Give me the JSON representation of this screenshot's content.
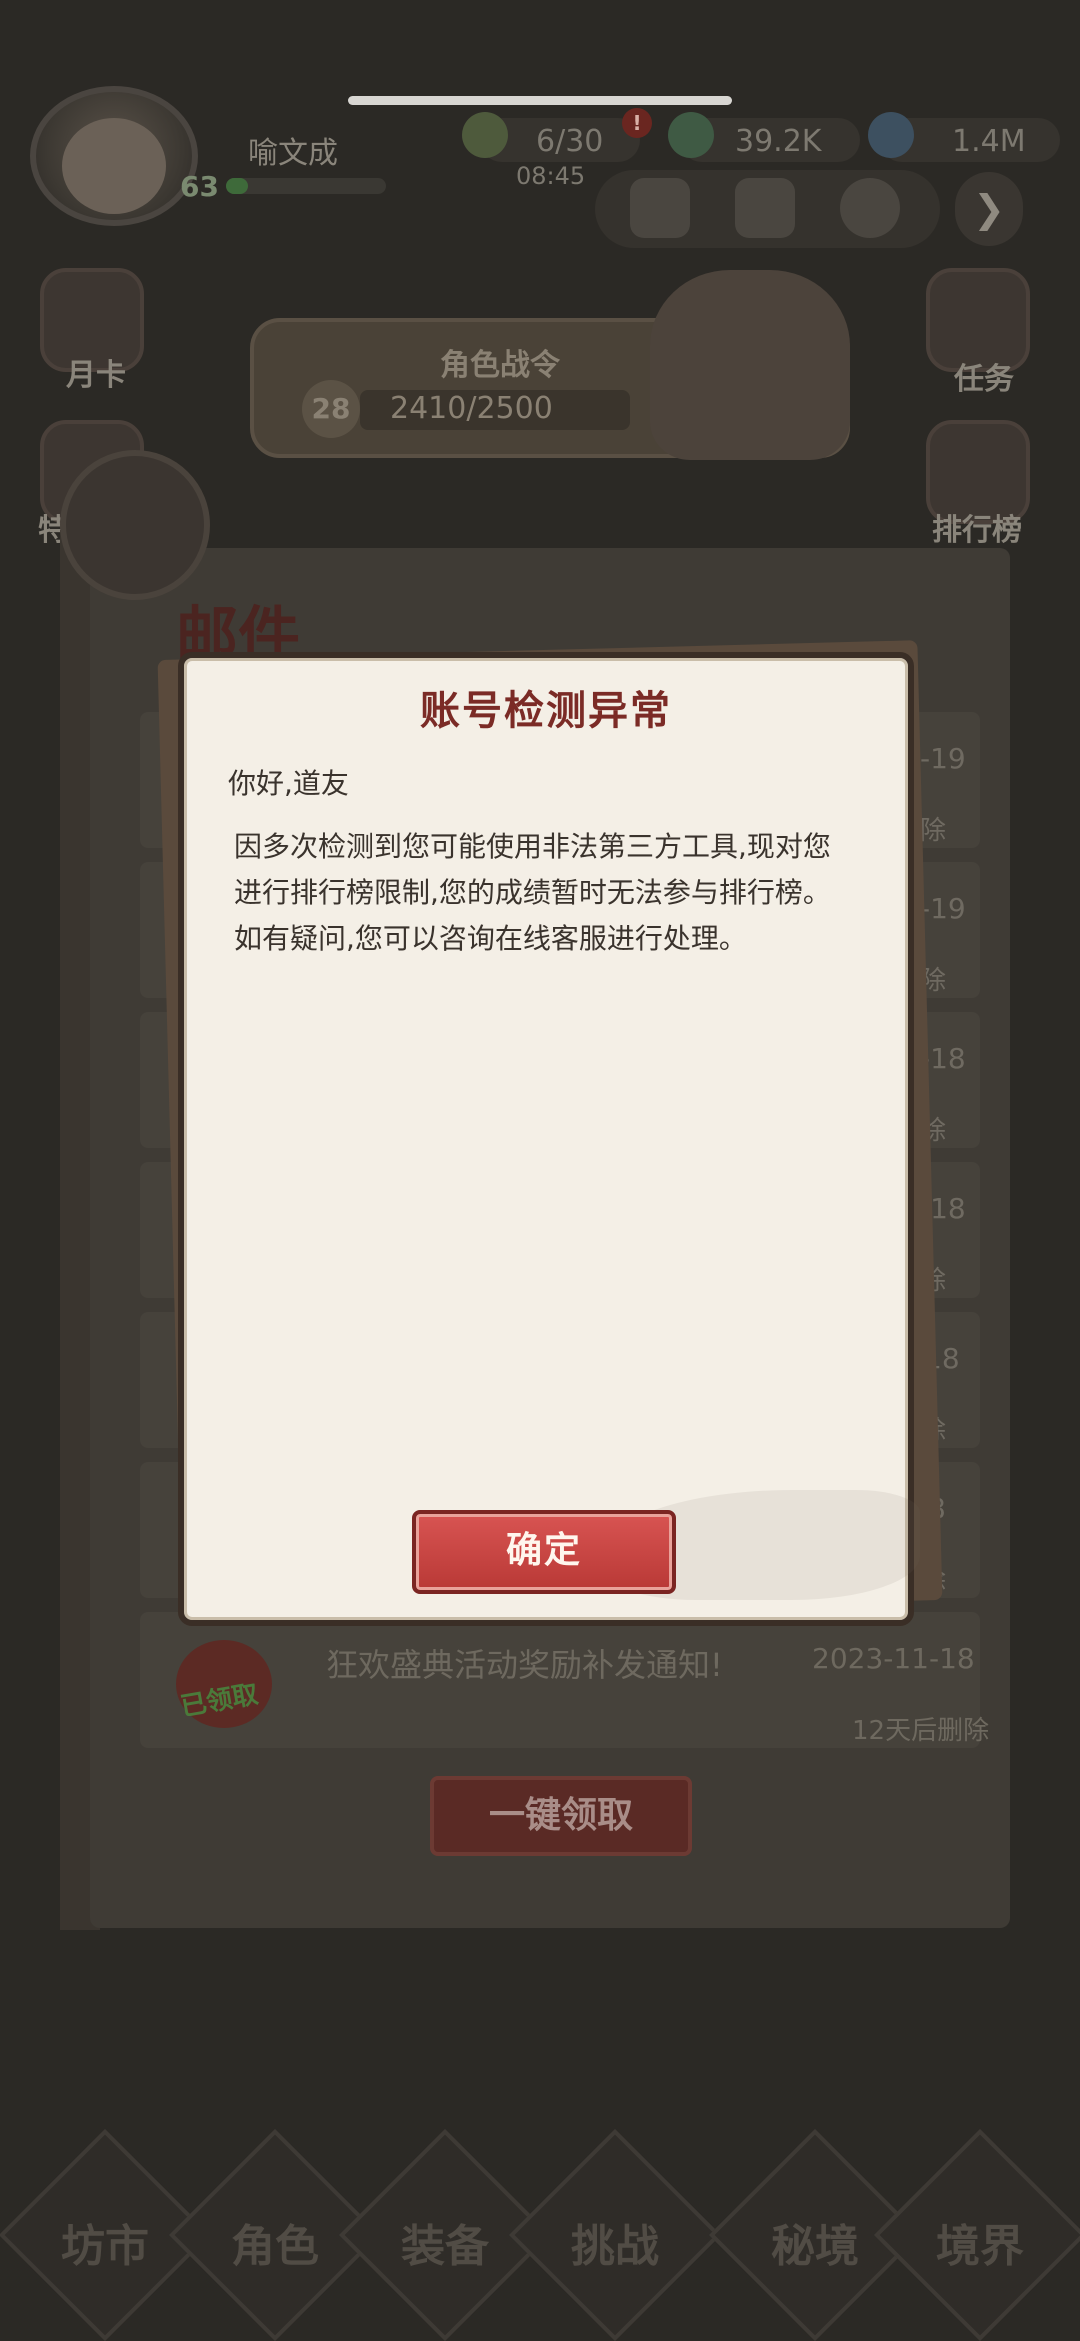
{
  "hud": {
    "player_name": "喻文成",
    "level": "63",
    "xp_fraction": 0.1,
    "stamina": "6/30",
    "stamina_timer": "08:45",
    "stamina_badge": "!",
    "jade": "39.2K",
    "gems": "1.4M",
    "next_arrow": "❯"
  },
  "side_left": {
    "monthly_card": "月卡",
    "special_offer": "特惠"
  },
  "side_right": {
    "tasks": "任务",
    "rankings": "排行榜"
  },
  "battle_pass": {
    "title": "角色战令",
    "level": "28",
    "progress": "2410/2500",
    "progress_fraction": 0.964
  },
  "mail": {
    "title": "邮件",
    "rows": [
      {
        "date": "-19",
        "delete": "除"
      },
      {
        "date": "-19",
        "delete": "除"
      },
      {
        "date": "-18",
        "delete": "除"
      },
      {
        "date": "-18",
        "delete": "除"
      },
      {
        "date": "18",
        "delete": "除"
      },
      {
        "date": "8",
        "delete": "除"
      }
    ],
    "last_row": {
      "title": "狂欢盛典活动奖励补发通知!",
      "date": "2023-11-18",
      "delete": "12天后删除",
      "status": "已领取"
    },
    "claim_all": "一键领取"
  },
  "bottom_nav": [
    "坊市",
    "角色",
    "装备",
    "挑战",
    "秘境",
    "境界"
  ],
  "dialog": {
    "title": "账号检测异常",
    "greeting": "你好,道友",
    "body": "因多次检测到您可能使用非法第三方工具,现对您进行排行榜限制,您的成绩暂时无法参与排行榜。如有疑问,您可以咨询在线客服进行处理。",
    "confirm": "确定"
  },
  "colors": {
    "dialog_bg": "#f4efe6",
    "dialog_title": "#7b2b26",
    "confirm_button": "#c9423f",
    "overlay": "#2b2925"
  }
}
